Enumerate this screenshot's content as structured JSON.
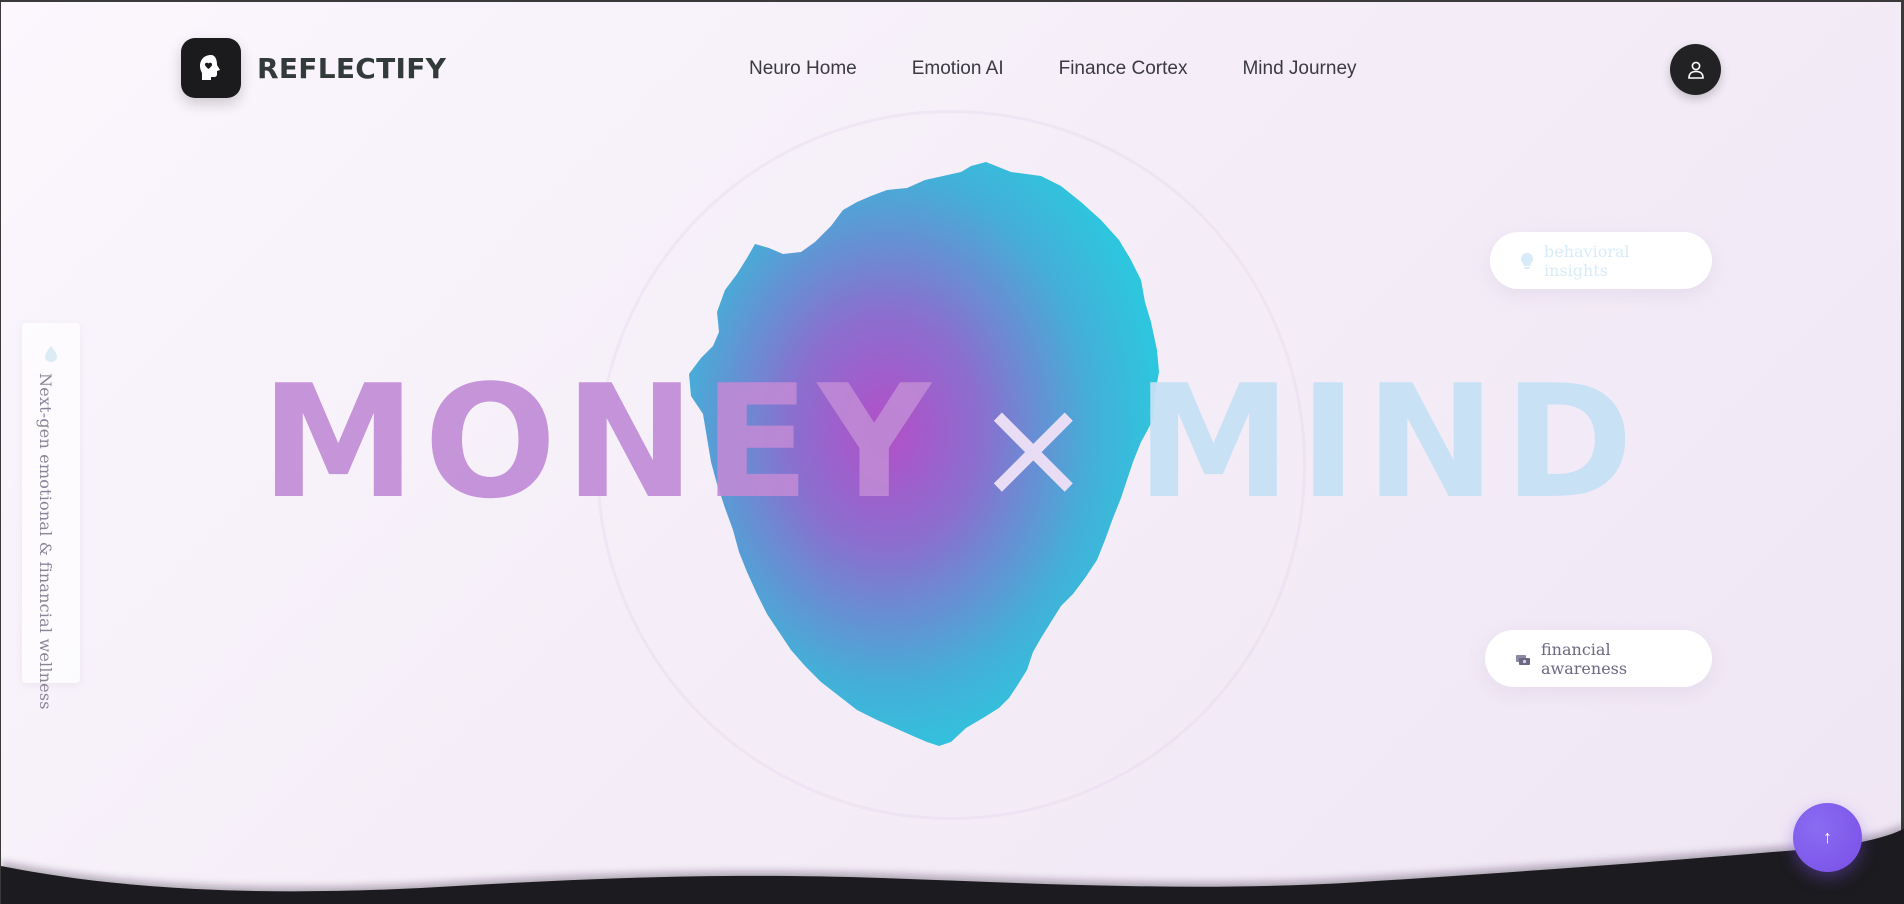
{
  "header": {
    "brand": "REFLECTIFY",
    "nav": [
      {
        "label": "Neuro Home"
      },
      {
        "label": "Emotion AI"
      },
      {
        "label": "Finance Cortex"
      },
      {
        "label": "Mind Journey"
      }
    ],
    "user_icon": "user-icon",
    "logo_icon": "head-heart-icon"
  },
  "side_tag": {
    "text": "Next-gen emotional & financial wellness",
    "icon": "droplet-icon"
  },
  "hero": {
    "word_left": "MONEY",
    "separator": "×",
    "word_right": "MIND"
  },
  "pills": {
    "insights": {
      "label": "behavioral insights",
      "icon": "lightbulb-icon"
    },
    "awareness": {
      "label": "financial awareness",
      "icon": "money-icon"
    }
  },
  "scroll_top": {
    "label": "↑"
  },
  "colors": {
    "blob_outer": "#2ec6de",
    "blob_inner": "#b44fc8",
    "money": "#c08ad6",
    "mind": "#c6e1f5",
    "dark": "#1b1b1d",
    "accent": "#7a4fe6"
  }
}
